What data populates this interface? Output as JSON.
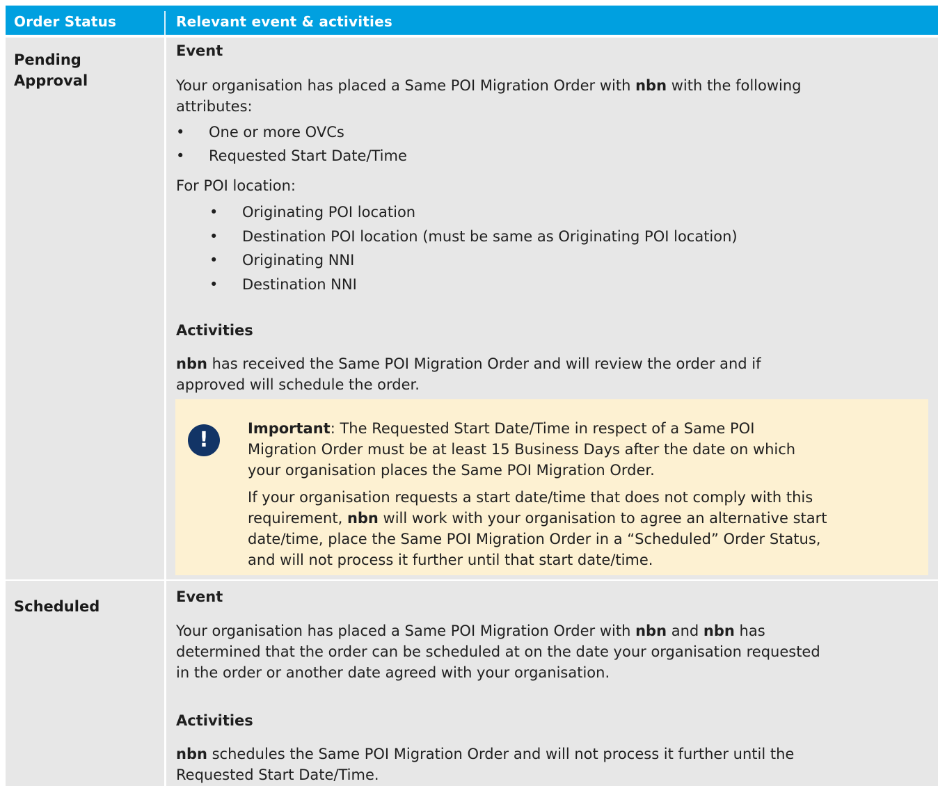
{
  "header": {
    "col1": "Order Status",
    "col2": "Relevant event & activities"
  },
  "rows": [
    {
      "status_line1": "Pending",
      "status_line2": "Approval",
      "event_heading": "Event",
      "event_p1_a": "Your organisation has placed a Same POI Migration Order with ",
      "event_p1_b": "nbn",
      "event_p1_c": " with the following",
      "event_p1_d": "attributes:",
      "attributes": [
        "One or more OVCs",
        "Requested Start Date/Time"
      ],
      "poi_intro": "For POI location:",
      "poi_items": [
        "Originating POI location",
        "Destination POI location (must be same as Originating POI location)",
        "Originating NNI",
        "Destination NNI"
      ],
      "activities_heading": "Activities",
      "act_a": "nbn",
      "act_b": " has received the Same POI Migration Order and will review the order and if",
      "act_c": "approved will schedule the order.",
      "note": {
        "icon": "!",
        "important_label": "Important",
        "l1": ": The Requested Start Date/Time in respect of a Same POI",
        "l2": "Migration Order must be at least 15 Business Days after the date on which",
        "l3": "your organisation places the Same POI Migration Order.",
        "l4": "If your organisation requests a start date/time that does not comply with this",
        "l5a": "requirement, ",
        "l5b": "nbn",
        "l5c": " will work with your organisation to agree an alternative start",
        "l6": "date/time, place the Same POI Migration Order in a “Scheduled” Order Status,",
        "l7": "and will not process it further until that start date/time."
      }
    },
    {
      "status_line1": "Scheduled",
      "event_heading": "Event",
      "e1a": "Your organisation has placed a Same POI Migration Order with ",
      "e1b": "nbn",
      "e1c": " and ",
      "e1d": "nbn",
      "e1e": " has",
      "e2": "determined that the order can be scheduled at on the date your organisation requested",
      "e3": "in the order or another date agreed with your organisation.",
      "activities_heading": "Activities",
      "a1a": "nbn",
      "a1b": " schedules the Same POI Migration Order and will not process it further until the",
      "a2": "Requested Start Date/Time."
    }
  ],
  "colors": {
    "header_bg": "#00a0e0",
    "row_bg": "#e7e7e7",
    "note_bg": "#fdf1d2",
    "icon_bg": "#123466"
  },
  "icons": {
    "note": "exclamation-circle-icon"
  }
}
